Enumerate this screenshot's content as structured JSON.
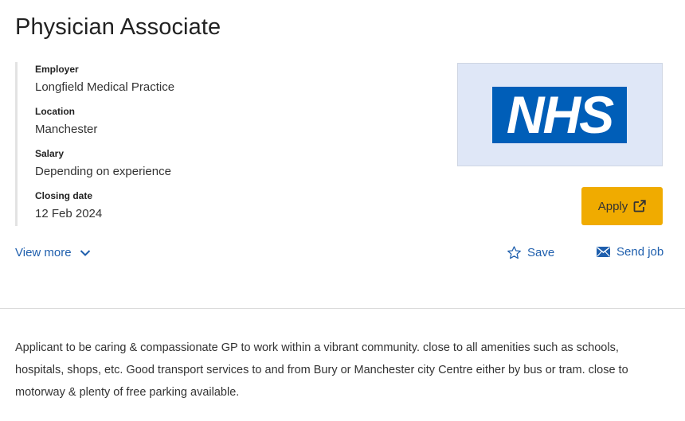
{
  "job": {
    "title": "Physician Associate"
  },
  "details": {
    "employer": {
      "label": "Employer",
      "value": "Longfield Medical Practice"
    },
    "location": {
      "label": "Location",
      "value": "Manchester"
    },
    "salary": {
      "label": "Salary",
      "value": "Depending on experience"
    },
    "closing_date": {
      "label": "Closing date",
      "value": "12 Feb 2024"
    }
  },
  "logo": {
    "text": "NHS",
    "background": "#005eb8",
    "box_color": "#dfe7f7"
  },
  "actions": {
    "apply_label": "Apply",
    "apply_icon": "external-link-icon",
    "apply_color": "#f0ab00",
    "view_more_label": "View more",
    "view_more_icon": "chevron-down-icon",
    "save_label": "Save",
    "save_icon": "star-icon",
    "send_label": "Send job",
    "send_icon": "envelope-icon",
    "link_color": "#1f5fad"
  },
  "description": "Applicant to be caring & compassionate GP to work within a vibrant community. close to all amenities such as schools, hospitals, shops, etc. Good transport services to and from Bury or Manchester city Centre either by bus or tram. close to motorway & plenty of free parking available."
}
